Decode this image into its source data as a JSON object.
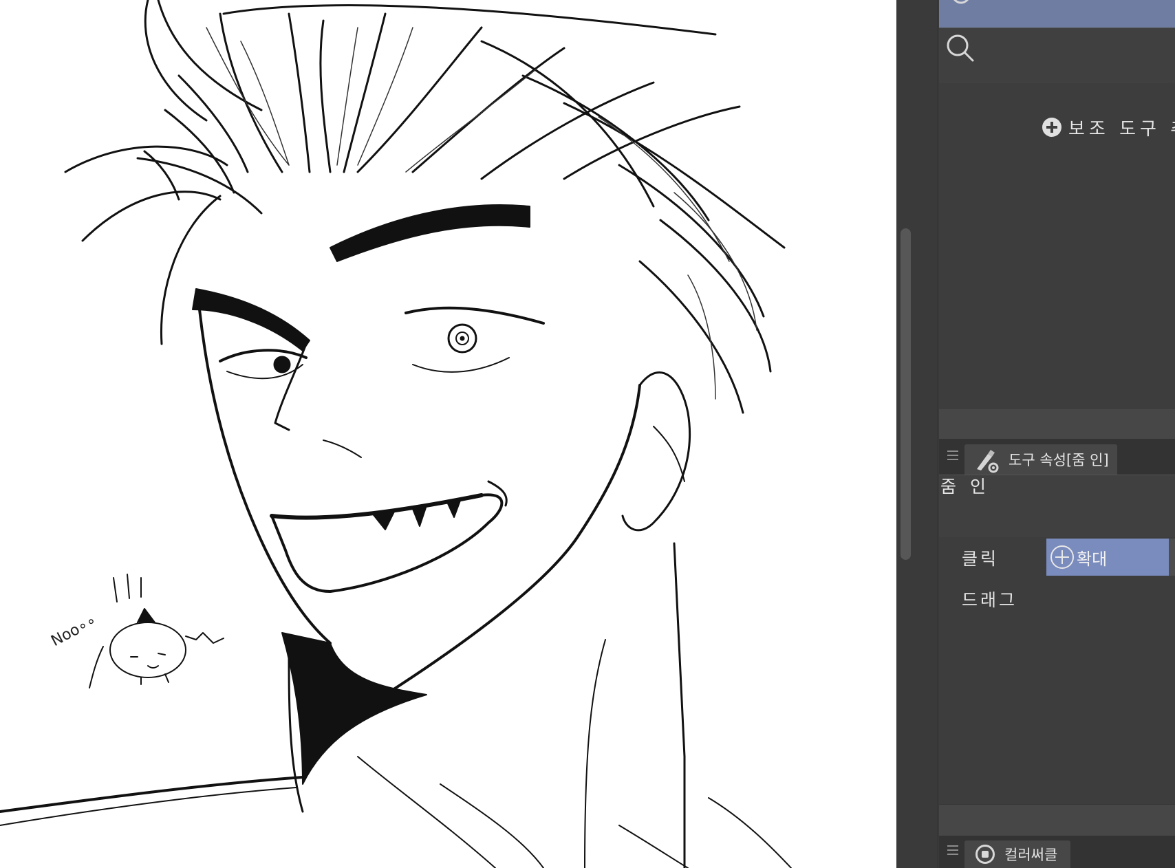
{
  "subtool_panel": {
    "add_subtool_label": "보조 도구 추",
    "search_icon": "search-icon",
    "add_icon": "plus-circle-icon"
  },
  "tool_property": {
    "tab_label": "도구 속성[줌 인]",
    "tab_icon": "brush-gear-icon",
    "tool_name": "줌 인",
    "click_label": "클릭",
    "click_value": "확대",
    "click_value_icon": "zoom-in-icon",
    "drag_label": "드래그"
  },
  "color_circle": {
    "tab_label": "컬러써클",
    "tab_icon": "color-circle-icon"
  },
  "colors": {
    "panel_bg": "#3f3f3f",
    "selection_accent": "#6f7da3",
    "value_highlight": "#7a8bbd",
    "canvas_bg": "#ffffff"
  },
  "canvas": {
    "sketch_text": "Noo∘∘"
  }
}
